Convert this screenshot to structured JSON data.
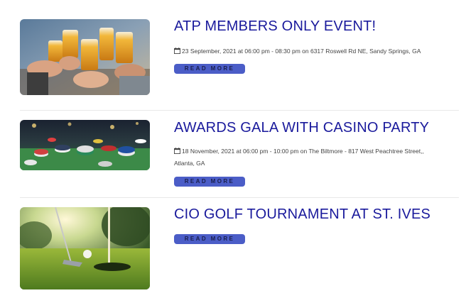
{
  "events": [
    {
      "title": "ATP MEMBERS ONLY EVENT!",
      "meta_line1": "23 September, 2021 at 06:00 pm - 08:30 pm on 6317 Roswell Rd NE, Sandy Springs, GA",
      "meta_line2": "",
      "button_label": "READ MORE",
      "image_icon": "beer-toast-photo"
    },
    {
      "title": "AWARDS GALA WITH CASINO PARTY",
      "meta_line1": "18 November, 2021 at 06:00 pm - 10:00 pm on The Biltmore - 817 West Peachtree Street,,",
      "meta_line2": "Atlanta, GA",
      "button_label": "READ MORE",
      "image_icon": "casino-chips-photo"
    },
    {
      "title": "CIO GOLF TOURNAMENT AT ST. IVES",
      "button_label": "READ MORE",
      "image_icon": "golf-hole-photo"
    }
  ],
  "colors": {
    "title": "#1a1a9c",
    "button_bg": "#4b5dc7",
    "button_text": "#1a1f4d",
    "divider": "#e8e8e8"
  }
}
